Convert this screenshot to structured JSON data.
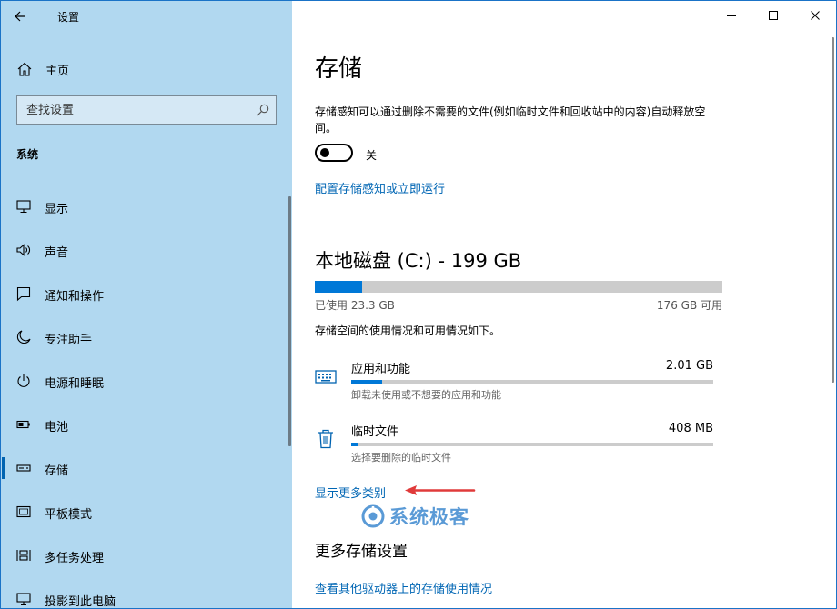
{
  "window": {
    "title": "设置",
    "controls": {
      "minimize": "minimize",
      "maximize": "maximize",
      "close": "close"
    }
  },
  "sidebar": {
    "home_label": "主页",
    "search_placeholder": "查找设置",
    "section": "系统",
    "items": [
      {
        "label": "显示",
        "icon": "monitor-icon",
        "active": false
      },
      {
        "label": "声音",
        "icon": "speaker-icon",
        "active": false
      },
      {
        "label": "通知和操作",
        "icon": "notification-icon",
        "active": false
      },
      {
        "label": "专注助手",
        "icon": "moon-icon",
        "active": false
      },
      {
        "label": "电源和睡眠",
        "icon": "power-icon",
        "active": false
      },
      {
        "label": "电池",
        "icon": "battery-icon",
        "active": false
      },
      {
        "label": "存储",
        "icon": "storage-icon",
        "active": true
      },
      {
        "label": "平板模式",
        "icon": "tablet-icon",
        "active": false
      },
      {
        "label": "多任务处理",
        "icon": "multitask-icon",
        "active": false
      },
      {
        "label": "投影到此电脑",
        "icon": "projection-icon",
        "active": false
      }
    ]
  },
  "main": {
    "title": "存储",
    "storage_sense": {
      "description": "存储感知可以通过删除不需要的文件(例如临时文件和回收站中的内容)自动释放空间。",
      "toggle_state": "关",
      "toggle_on": false,
      "configure_link": "配置存储感知或立即运行"
    },
    "disk": {
      "title": "本地磁盘 (C:) - 199 GB",
      "used_label": "已使用 23.3 GB",
      "free_label": "176 GB 可用",
      "used_fraction": 0.117,
      "usage_description": "存储空间的使用情况和可用情况如下。",
      "categories": [
        {
          "name": "应用和功能",
          "size": "2.01 GB",
          "description": "卸载未使用或不想要的应用和功能",
          "fraction": 0.085,
          "icon": "keyboard-icon"
        },
        {
          "name": "临时文件",
          "size": "408 MB",
          "description": "选择要删除的临时文件",
          "fraction": 0.017,
          "icon": "trash-icon"
        }
      ],
      "show_more_link": "显示更多类别"
    },
    "more_settings": {
      "heading": "更多存储设置",
      "other_drives_link": "查看其他驱动器上的存储使用情况"
    }
  },
  "watermark": {
    "text": "系统极客"
  },
  "colors": {
    "sidebar_bg": "#b1d8f0",
    "accent": "#0078d7",
    "link": "#0066b4",
    "annotation": "#e03a3a",
    "watermark": "#5a9ad6"
  }
}
